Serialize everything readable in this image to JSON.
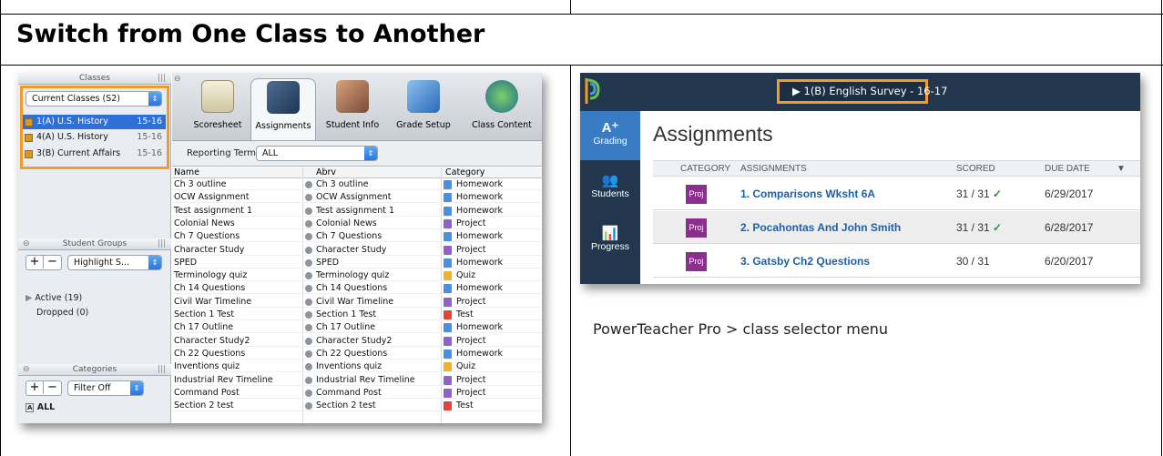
{
  "section_title": "Switch from One Class to Another",
  "left_app": {
    "classes_header": "Classes",
    "class_filter": "Current Classes (S2)",
    "classes": [
      {
        "name": "1(A) U.S. History",
        "term": "15-16",
        "selected": true
      },
      {
        "name": "4(A) U.S. History",
        "term": "15-16",
        "selected": false
      },
      {
        "name": "3(B) Current Affairs",
        "term": "15-16",
        "selected": false
      }
    ],
    "student_groups_header": "Student Groups",
    "student_groups_select": "Highlight S...",
    "active_label": "Active (19)",
    "dropped_label": "Dropped (0)",
    "categories_header": "Categories",
    "categories_select": "Filter Off",
    "all_label": "ALL",
    "toolbar": [
      "Scoresheet",
      "Assignments",
      "Student Info",
      "Grade Setup",
      "Class Content"
    ],
    "reporting_term_label": "Reporting Term:",
    "reporting_term_value": "ALL",
    "columns": {
      "name": "Name",
      "abrv": "Abrv",
      "category": "Category"
    },
    "rows": [
      {
        "name": "Ch 3 outline",
        "abrv": "Ch 3 outline",
        "category": "Homework"
      },
      {
        "name": "OCW Assignment",
        "abrv": "OCW Assignment",
        "category": "Homework"
      },
      {
        "name": "Test assignment 1",
        "abrv": "Test assignment 1",
        "category": "Homework"
      },
      {
        "name": "Colonial News",
        "abrv": "Colonial News",
        "category": "Project"
      },
      {
        "name": "Ch 7 Questions",
        "abrv": "Ch 7 Questions",
        "category": "Homework"
      },
      {
        "name": "Character Study",
        "abrv": "Character Study",
        "category": "Project"
      },
      {
        "name": "SPED",
        "abrv": "SPED",
        "category": "Homework"
      },
      {
        "name": "Terminology quiz",
        "abrv": "Terminology quiz",
        "category": "Quiz"
      },
      {
        "name": "Ch 14 Questions",
        "abrv": "Ch 14 Questions",
        "category": "Homework"
      },
      {
        "name": "Civil War Timeline",
        "abrv": "Civil War Timeline",
        "category": "Project"
      },
      {
        "name": "Section 1 Test",
        "abrv": "Section 1 Test",
        "category": "Test"
      },
      {
        "name": "Ch 17 Outline",
        "abrv": "Ch 17 Outline",
        "category": "Homework"
      },
      {
        "name": "Character Study2",
        "abrv": "Character Study2",
        "category": "Project"
      },
      {
        "name": "Ch 22 Questions",
        "abrv": "Ch 22 Questions",
        "category": "Homework"
      },
      {
        "name": "Inventions quiz",
        "abrv": "Inventions quiz",
        "category": "Quiz"
      },
      {
        "name": "Industrial Rev Timeline",
        "abrv": "Industrial Rev Timeline",
        "category": "Project"
      },
      {
        "name": "Command Post",
        "abrv": "Command Post",
        "category": "Project"
      },
      {
        "name": "Section 2 test",
        "abrv": "Section 2 test",
        "category": "Test"
      }
    ],
    "category_colors": {
      "Homework": "#4a90e2",
      "Project": "#8e63c9",
      "Quiz": "#f0b429",
      "Test": "#e0443a"
    }
  },
  "right_app": {
    "class_button": "▶  1(B) English Survey  -  16-17",
    "nav": [
      {
        "icon": "A⁺",
        "label": "Grading"
      },
      {
        "icon": "👥",
        "label": "Students"
      },
      {
        "icon": "📊",
        "label": "Progress"
      }
    ],
    "title": "Assignments",
    "columns": {
      "category": "CATEGORY",
      "assignments": "ASSIGNMENTS",
      "scored": "SCORED",
      "due": "DUE DATE"
    },
    "rows": [
      {
        "badge": "Proj",
        "assignment": "1. Comparisons Wksht 6A",
        "scored": "31 / 31",
        "check": "✓",
        "due": "6/29/2017"
      },
      {
        "badge": "Proj",
        "assignment": "2. Pocahontas And John Smith",
        "scored": "31 / 31",
        "check": "✓",
        "due": "6/28/2017"
      },
      {
        "badge": "Proj",
        "assignment": "3. Gatsby Ch2 Questions",
        "scored": "30 / 31",
        "check": "",
        "due": "6/20/2017"
      }
    ],
    "accent_color": "#f39a2b",
    "navy_color": "#22374d"
  },
  "caption": "PowerTeacher Pro > class selector menu"
}
